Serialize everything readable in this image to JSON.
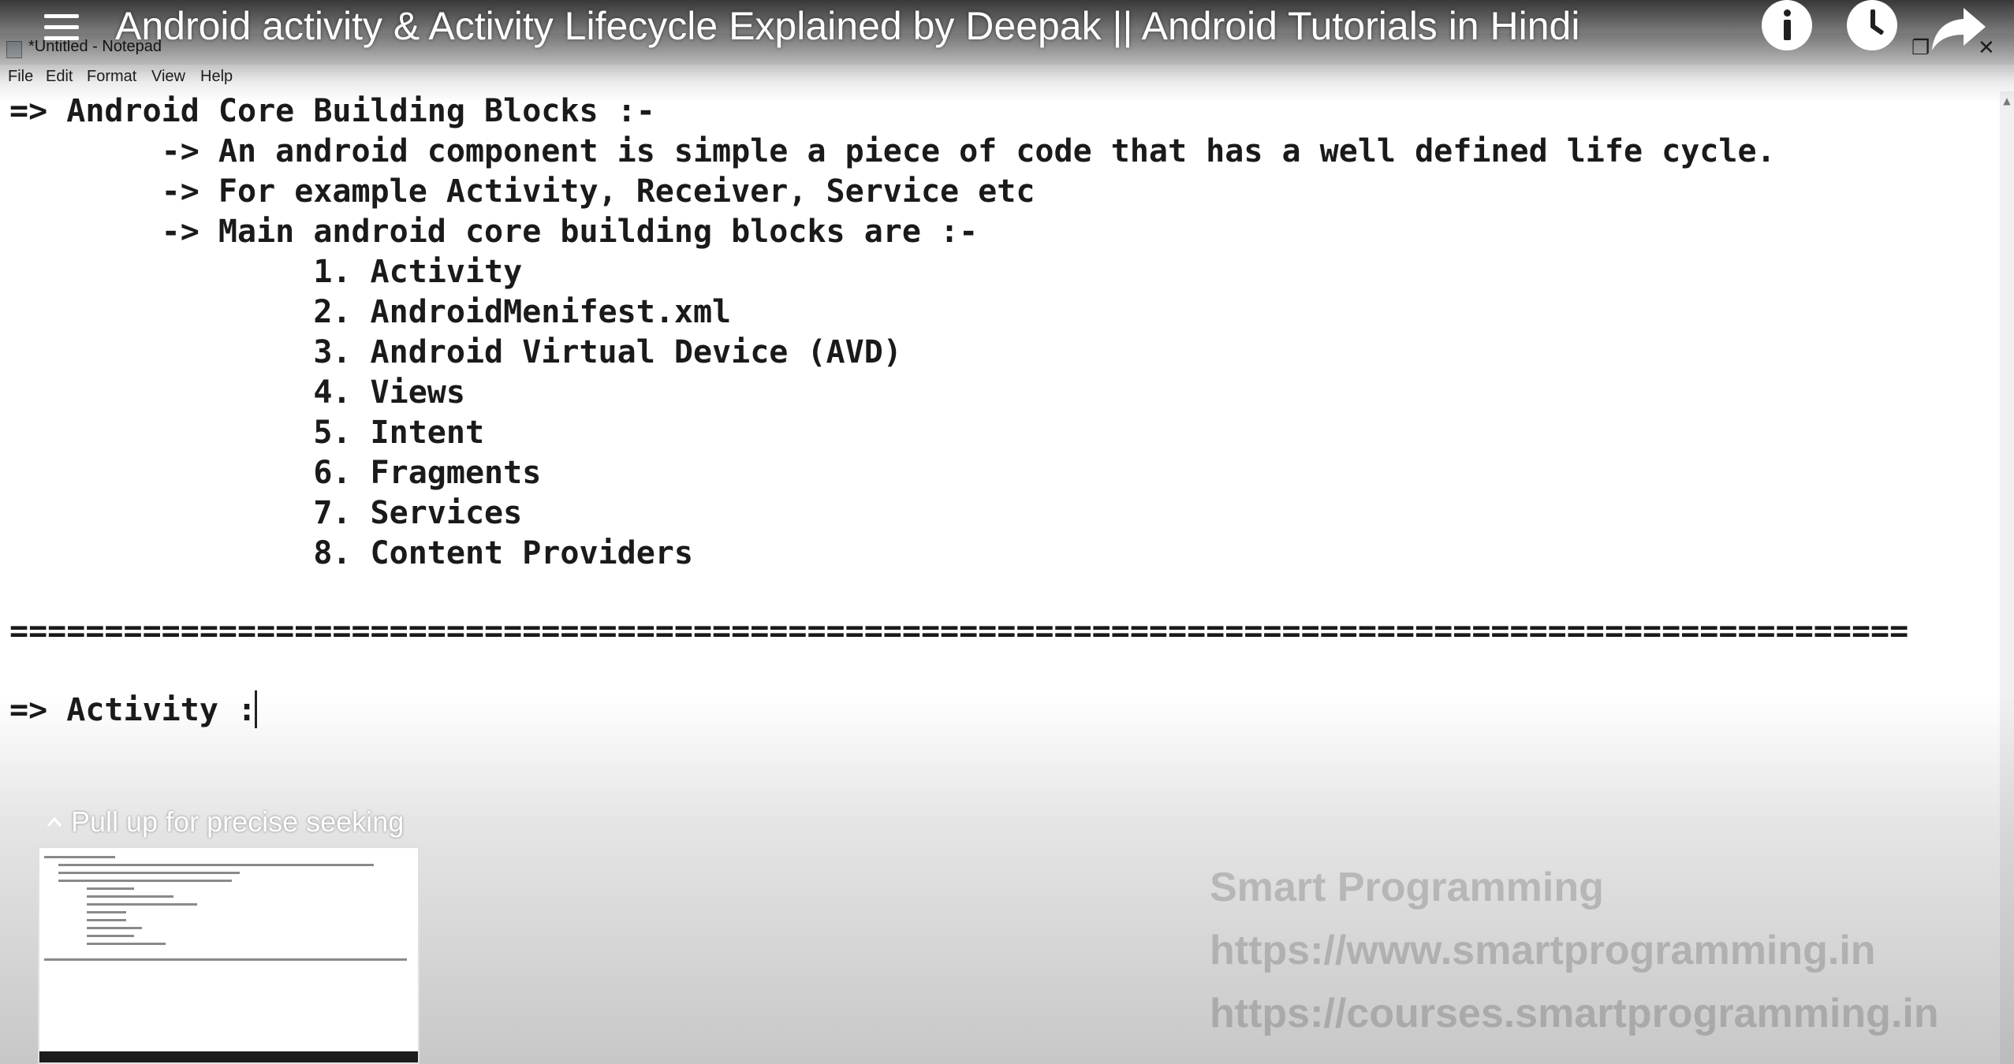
{
  "youtube": {
    "video_title": "Android activity & Activity Lifecycle Explained by Deepak || Android Tutorials in Hindi",
    "seek_hint": "Pull up for precise seeking"
  },
  "notepad": {
    "window_title": "*Untitled - Notepad",
    "menu": [
      "File",
      "Edit",
      "Format",
      "View",
      "Help"
    ],
    "window_buttons": {
      "restore": "❐",
      "close": "✕"
    },
    "lines": [
      "=> Android Core Building Blocks :-",
      "        -> An android component is simple a piece of code that has a well defined life cycle.",
      "        -> For example Activity, Receiver, Service etc",
      "        -> Main android core building blocks are :-",
      "                1. Activity",
      "                2. AndroidMenifest.xml",
      "                3. Android Virtual Device (AVD)",
      "                4. Views",
      "                5. Intent",
      "                6. Fragments",
      "                7. Services",
      "                8. Content Providers",
      "",
      "====================================================================================================",
      "",
      "=> Activity :"
    ]
  },
  "watermark": {
    "name": "Smart Programming",
    "url1": "https://www.smartprogramming.in",
    "url2": "https://courses.smartprogramming.in"
  }
}
